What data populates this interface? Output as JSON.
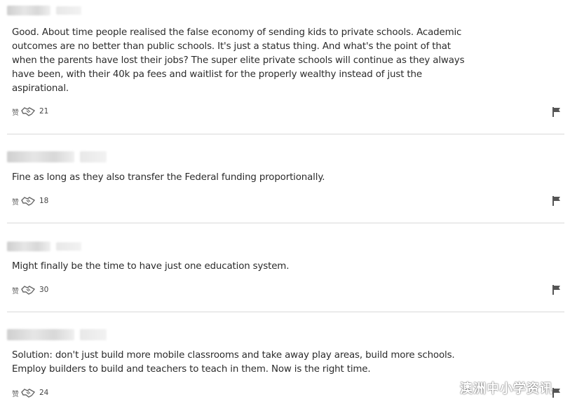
{
  "comments": [
    {
      "body": "Good. About time people realised the false economy of sending kids to private schools. Academic outcomes are no better than public schools. It's just a status thing. And what's the point of that when the parents have lost their jobs? The super elite private schools will continue as they always have been, with their 40k pa fees and waitlist for the properly wealthy instead of just the aspirational.",
      "like_label": "赞",
      "likes": "21"
    },
    {
      "body": "Fine as long as they also transfer the Federal funding proportionally.",
      "like_label": "赞",
      "likes": "18"
    },
    {
      "body": "Might finally be the time to have just one education system.",
      "like_label": "赞",
      "likes": "30"
    },
    {
      "body": "Solution: don't just build more mobile classrooms and take away play areas, build more schools. Employ builders to build and teachers to teach in them. Now is the right time.",
      "like_label": "赞",
      "likes": "24"
    }
  ],
  "watermark": {
    "text": "澳洲中小学资讯",
    "icon": "wechat-icon"
  },
  "icons": {
    "like": "handshake-icon",
    "report": "flag-icon"
  }
}
